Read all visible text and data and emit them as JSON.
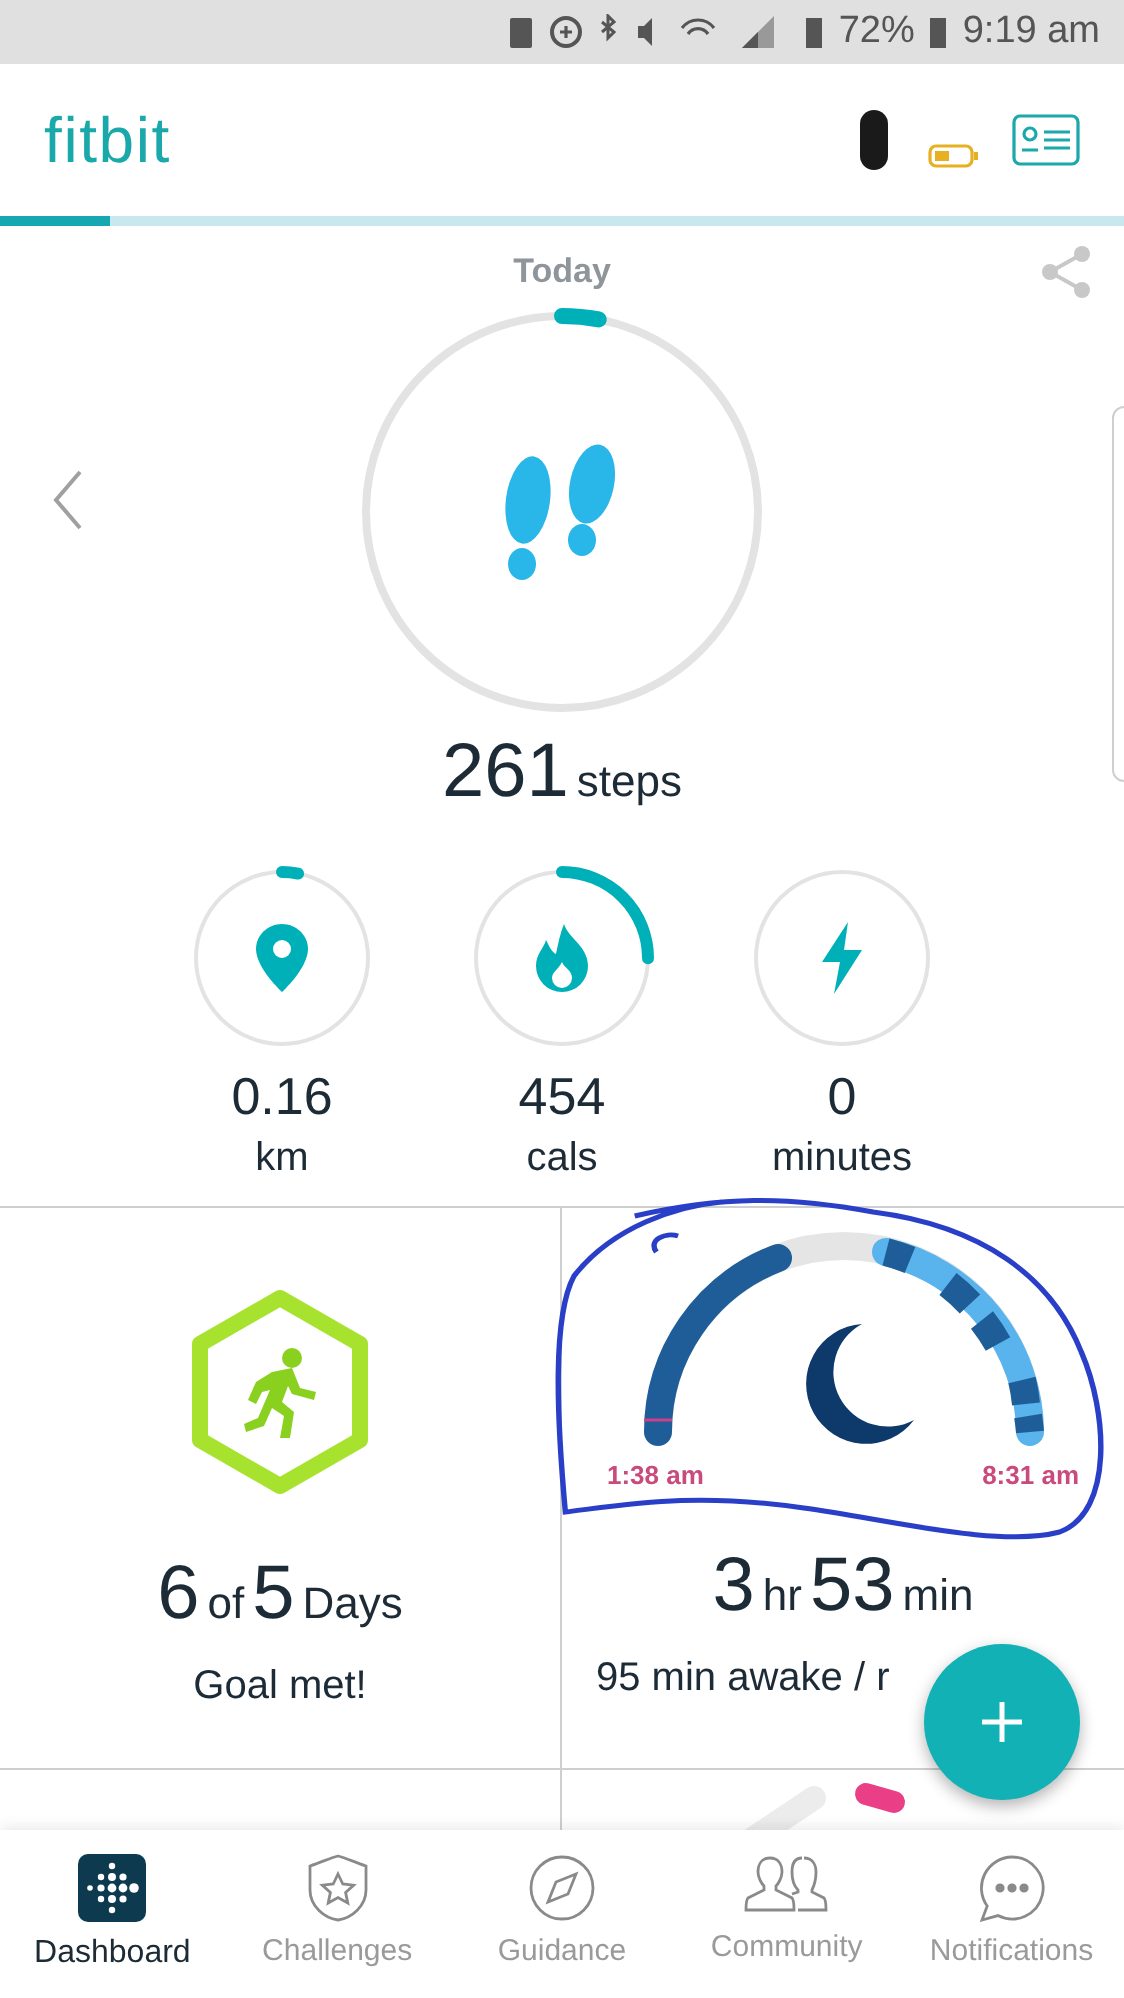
{
  "status_bar": {
    "battery": "72%",
    "time": "9:19 am"
  },
  "header": {
    "logo": "fitbit"
  },
  "today": {
    "title": "Today",
    "steps": {
      "value": "261",
      "unit": "steps"
    }
  },
  "stats": [
    {
      "kind": "distance",
      "value": "0.16",
      "unit": "km"
    },
    {
      "kind": "calories",
      "value": "454",
      "unit": "cals"
    },
    {
      "kind": "active",
      "value": "0",
      "unit": "minutes"
    }
  ],
  "tiles": [
    {
      "kind": "exercise",
      "parts": [
        {
          "kind": "number",
          "text": "6"
        },
        {
          "kind": "unit",
          "text": "of"
        },
        {
          "kind": "number",
          "text": "5"
        },
        {
          "kind": "unit",
          "text": "Days"
        }
      ],
      "caption": "Goal met!"
    },
    {
      "kind": "sleep",
      "start": "1:38 am",
      "end": "8:31 am",
      "parts": [
        {
          "kind": "number",
          "text": "3"
        },
        {
          "kind": "unit",
          "text": "hr"
        },
        {
          "kind": "number",
          "text": "53"
        },
        {
          "kind": "unit",
          "text": "min"
        }
      ],
      "caption": "95 min awake / r"
    }
  ],
  "nav": [
    {
      "kind": "dashboard",
      "label": "Dashboard",
      "selected": true
    },
    {
      "kind": "challenges",
      "label": "Challenges",
      "selected": false
    },
    {
      "kind": "guidance",
      "label": "Guidance",
      "selected": false
    },
    {
      "kind": "community",
      "label": "Community",
      "selected": false
    },
    {
      "kind": "notifications",
      "label": "Notifications",
      "selected": false
    }
  ]
}
